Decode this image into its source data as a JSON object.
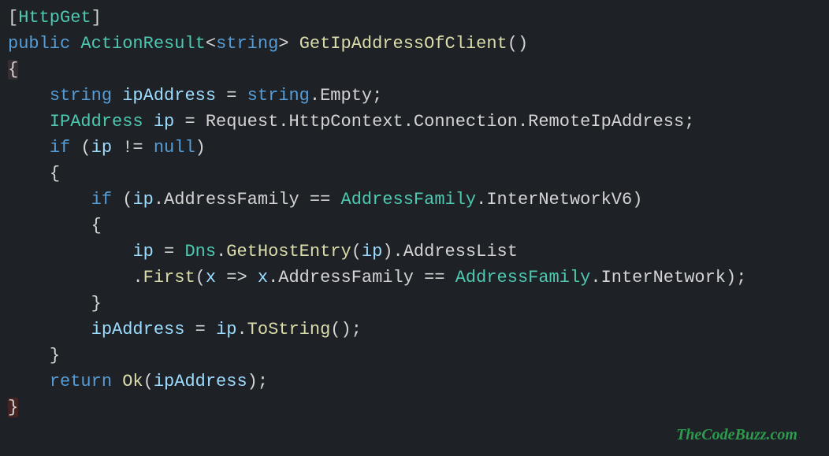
{
  "code": {
    "attr_open": "[",
    "attr_name": "HttpGet",
    "attr_close": "]",
    "kw_public": "public",
    "type_action": "ActionResult",
    "lt": "<",
    "kw_string": "string",
    "gt": ">",
    "method_name": "GetIpAddressOfClient",
    "paren_open": "(",
    "paren_close": ")",
    "brace_open": "{",
    "brace_close": "}",
    "var_ipAddress": "ipAddress",
    "eq": "=",
    "string_type": "string",
    "dot": ".",
    "empty": "Empty",
    "semi": ";",
    "type_IPAddress": "IPAddress",
    "var_ip": "ip",
    "request": "Request",
    "httpcontext": "HttpContext",
    "connection": "Connection",
    "remoteip": "RemoteIpAddress",
    "kw_if": "if",
    "neq": "!=",
    "kw_null": "null",
    "addressfamily_prop": "AddressFamily",
    "eqeq": "==",
    "enum_AddressFamily": "AddressFamily",
    "enum_InterNetworkV6": "InterNetworkV6",
    "enum_InterNetwork": "InterNetwork",
    "type_Dns": "Dns",
    "gethostentry": "GetHostEntry",
    "addresslist": "AddressList",
    "first": "First",
    "lambda_x": "x",
    "arrow": "=>",
    "tostring": "ToString",
    "kw_return": "return",
    "ok": "Ok"
  },
  "watermark": "TheCodeBuzz.com"
}
